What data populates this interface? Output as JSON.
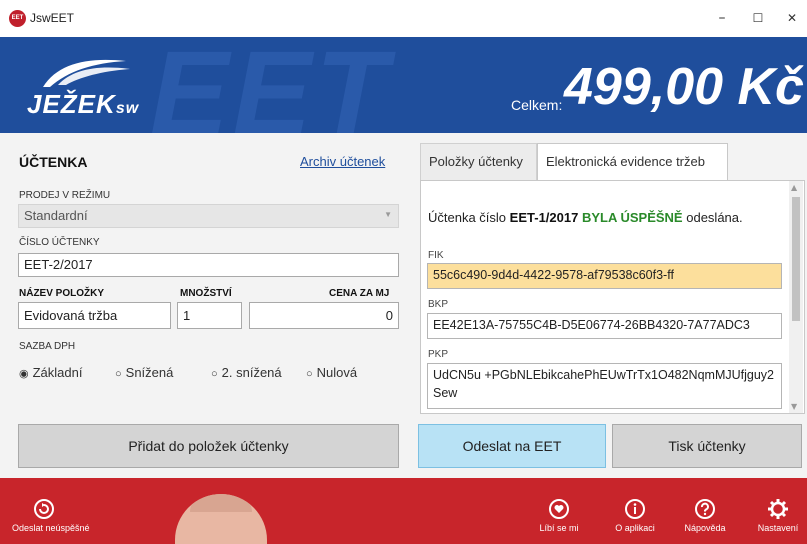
{
  "window": {
    "title": "JswEET",
    "icon_text": "EET",
    "minimize": "–",
    "maximize": "☐",
    "close": "✕"
  },
  "header": {
    "bg_text": "EET",
    "logo_main": "JEŽEK",
    "logo_sub": "sw",
    "total_label": "Celkem:",
    "total_value": "499,00 Kč"
  },
  "receipt": {
    "title": "ÚČTENKA",
    "archive_link": "Archiv účtenek",
    "sale_mode_label": "PRODEJ V REŽIMU",
    "sale_mode_value": "Standardní",
    "receipt_no_label": "ČÍSLO ÚČTENKY",
    "receipt_no_value": "EET-2/2017",
    "item_name_label": "NÁZEV POLOŽKY",
    "quantity_label": "MNOŽSTVÍ",
    "price_label": "CENA ZA MJ",
    "item_name_value": "Evidovaná tržba",
    "quantity_value": "1",
    "price_value": "0",
    "vat_label": "SAZBA DPH",
    "vat_options": [
      {
        "label": "Základní",
        "selected": true
      },
      {
        "label": "Snížená",
        "selected": false
      },
      {
        "label": "2. snížená",
        "selected": false
      },
      {
        "label": "Nulová",
        "selected": false
      }
    ]
  },
  "tabs": {
    "items": "Položky účtenky",
    "eet": "Elektronická evidence tržeb"
  },
  "eet": {
    "status_prefix": "Účtenka číslo",
    "receipt_number": "EET-1/2017",
    "status_result": "BYLA ÚSPĚŠNĚ",
    "status_suffix": "odeslána.",
    "fik_label": "FIK",
    "fik_value": "55c6c490-9d4d-4422-9578-af79538c60f3-ff",
    "bkp_label": "BKP",
    "bkp_value": "EE42E13A-75755C4B-D5E06774-26BB4320-7A77ADC3",
    "pkp_label": "PKP",
    "pkp_value": "UdCN5u +PGbNLEbikcahePhEUwTrTx1O482NqmMJUfjguy2Sew"
  },
  "buttons": {
    "add": "Přidat do položek účtenky",
    "send": "Odeslat na EET",
    "print": "Tisk účtenky"
  },
  "footer": {
    "unsent": "Odeslat neúspěšné",
    "like": "Líbí se mi",
    "about": "O aplikaci",
    "help": "Nápověda",
    "settings": "Nastavení"
  },
  "colors": {
    "header_blue": "#1f4e9c",
    "footer_red": "#c8252b",
    "fik_highlight": "#fcdf9c",
    "success_green": "#2a8a2a",
    "send_button": "#b8e2f5"
  }
}
